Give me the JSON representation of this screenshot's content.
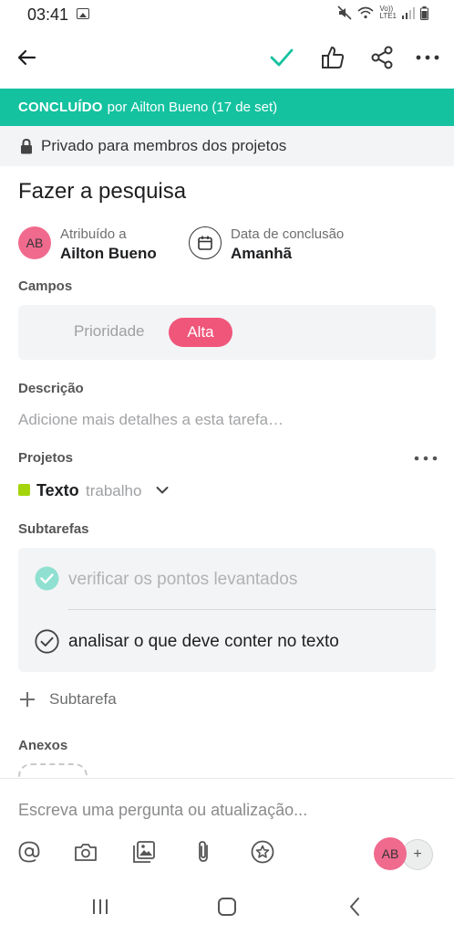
{
  "status_bar": {
    "time": "03:41",
    "network_label_top": "Vo))",
    "network_label_bottom": "LTE1"
  },
  "top_bar": {
    "back_icon": "arrow-left-icon",
    "complete_icon": "checkmark-icon",
    "like_icon": "thumbs-up-icon",
    "share_icon": "share-icon",
    "more_icon": "more-horizontal-icon",
    "accent_color": "#14c2a0"
  },
  "banner": {
    "status": "CONCLUÍDO",
    "by": "por",
    "user": "Ailton Bueno",
    "date": "(17 de set)",
    "color": "#14c2a0"
  },
  "privacy": {
    "text": "Privado para membros dos projetos",
    "icon": "lock-icon"
  },
  "task": {
    "title": "Fazer a pesquisa"
  },
  "assignee": {
    "label": "Atribuído a",
    "name": "Ailton Bueno",
    "initials": "AB"
  },
  "due_date": {
    "label": "Data de conclusão",
    "value": "Amanhã",
    "icon": "calendar-icon"
  },
  "fields": {
    "heading": "Campos",
    "items": [
      {
        "name": "Prioridade",
        "value": "Alta",
        "color": "#f0557a"
      }
    ]
  },
  "description": {
    "heading": "Descrição",
    "placeholder": "Adicione mais detalhes a esta tarefa…"
  },
  "projects": {
    "heading": "Projetos",
    "items": [
      {
        "name": "Texto",
        "section": "trabalho",
        "color": "#a4d40a"
      }
    ]
  },
  "subtasks": {
    "heading": "Subtarefas",
    "items": [
      {
        "text": "verificar os pontos levantados",
        "completed": true
      },
      {
        "text": "analisar o que deve conter no texto",
        "completed": false
      }
    ],
    "add_label": "Subtarefa"
  },
  "attachments": {
    "heading": "Anexos"
  },
  "comment": {
    "placeholder": "Escreva uma pergunta ou atualização...",
    "tools": [
      "at-mention-icon",
      "camera-icon",
      "gallery-icon",
      "paperclip-icon",
      "star-icon"
    ],
    "collaborator_initials": "AB",
    "add_collaborator": "+"
  },
  "system_nav": {
    "recents_icon": "recent-apps-icon",
    "home_icon": "home-icon",
    "back_icon": "back-chevron-icon"
  }
}
